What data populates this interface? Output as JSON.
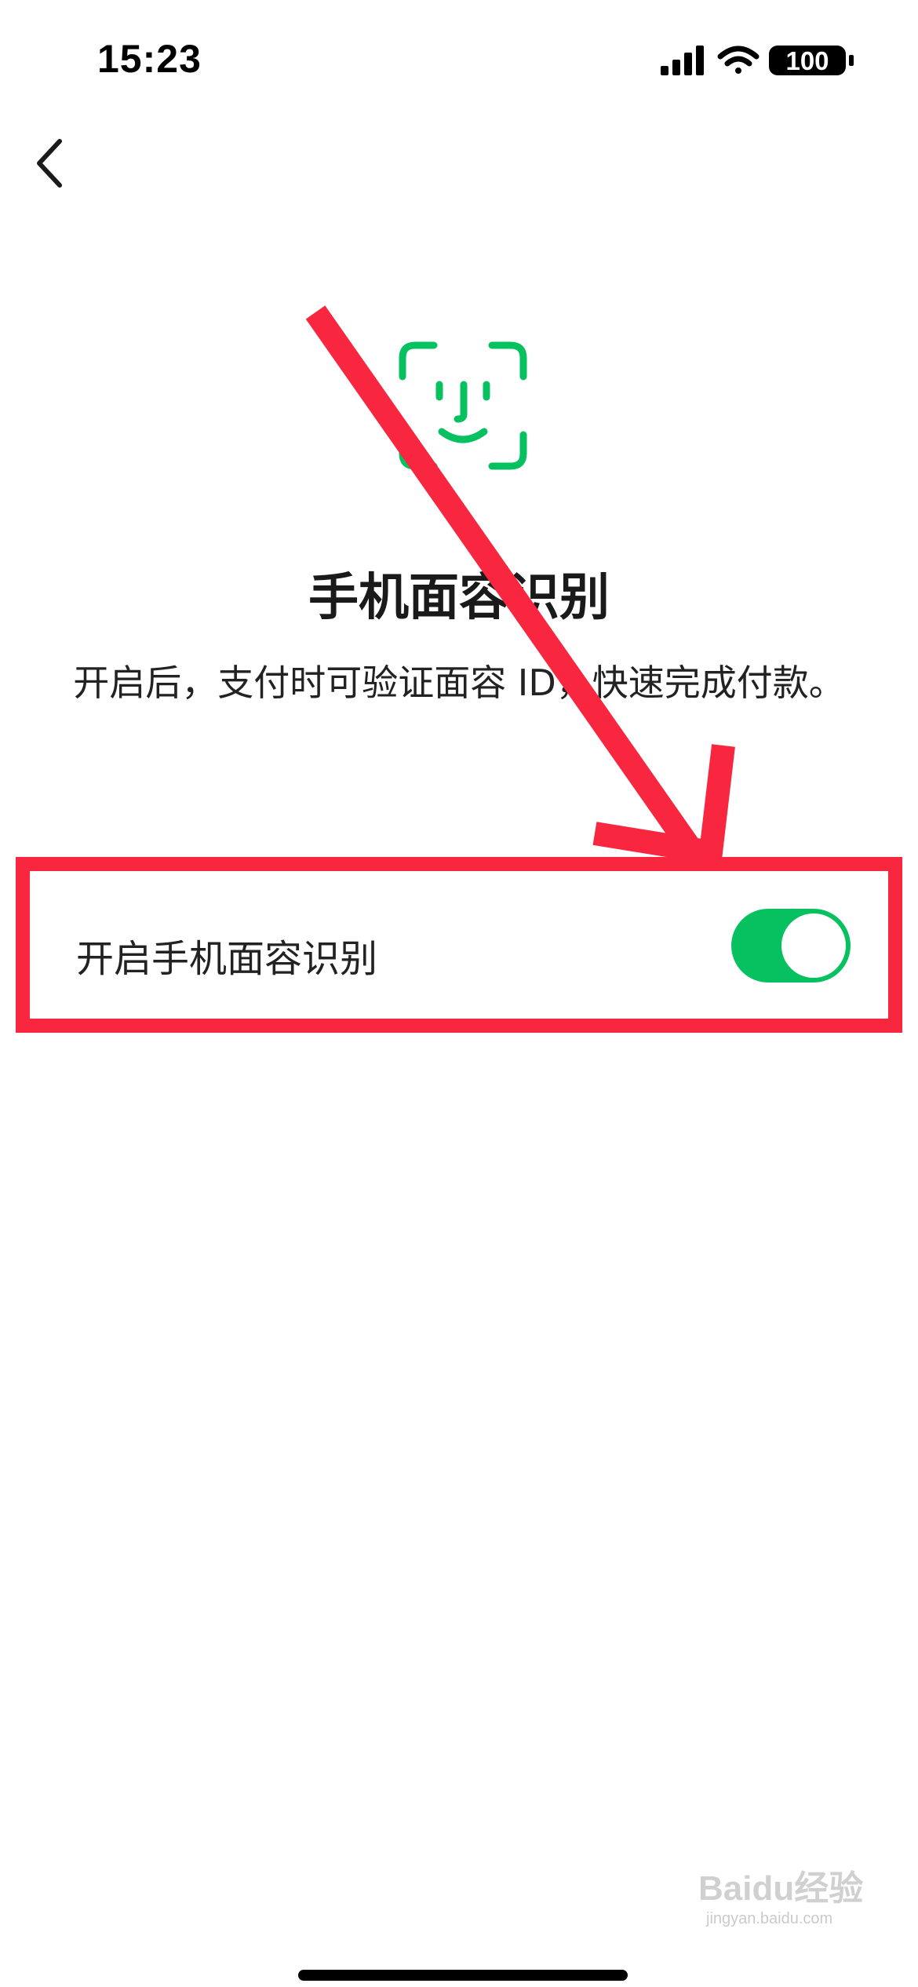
{
  "status_bar": {
    "time": "15:23",
    "battery": "100",
    "icons": [
      "signal-icon",
      "wifi-icon",
      "battery-icon"
    ]
  },
  "nav": {
    "back_icon": "chevron-left-icon"
  },
  "hero": {
    "icon": "face-id-icon",
    "icon_color": "#07c160",
    "title": "手机面容识别",
    "description": "开启后，支付时可验证面容 ID，快速完成付款。"
  },
  "setting": {
    "label": "开启手机面容识别",
    "toggle_on": true,
    "toggle_color": "#07c160"
  },
  "annotation": {
    "color": "#f8263f"
  },
  "watermark": {
    "text": "Baidu经验",
    "sub": "jingyan.baidu.com"
  }
}
